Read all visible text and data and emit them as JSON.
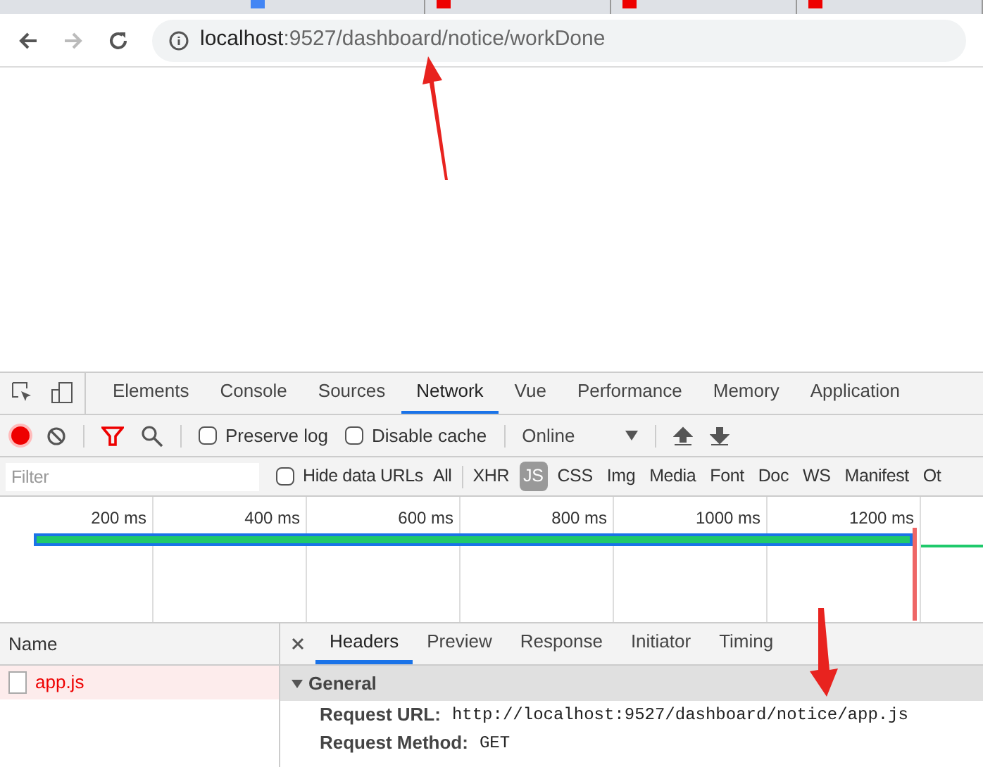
{
  "browser": {
    "url_host": "localhost",
    "url_rest": ":9527/dashboard/notice/workDone"
  },
  "devtools": {
    "tabs": [
      {
        "label": "Elements",
        "selected": false
      },
      {
        "label": "Console",
        "selected": false
      },
      {
        "label": "Sources",
        "selected": false
      },
      {
        "label": "Network",
        "selected": true
      },
      {
        "label": "Vue",
        "selected": false
      },
      {
        "label": "Performance",
        "selected": false
      },
      {
        "label": "Memory",
        "selected": false
      },
      {
        "label": "Application",
        "selected": false
      }
    ],
    "toolbar": {
      "preserve_log": {
        "label": "Preserve log",
        "checked": false
      },
      "disable_cache": {
        "label": "Disable cache",
        "checked": false
      },
      "throttle": "Online"
    },
    "filter": {
      "placeholder": "Filter",
      "hide_data_urls": {
        "label": "Hide data URLs",
        "checked": false
      },
      "types": [
        {
          "label": "All",
          "selected": false
        },
        {
          "label": "XHR",
          "selected": false
        },
        {
          "label": "JS",
          "selected": true
        },
        {
          "label": "CSS",
          "selected": false
        },
        {
          "label": "Img",
          "selected": false
        },
        {
          "label": "Media",
          "selected": false
        },
        {
          "label": "Font",
          "selected": false
        },
        {
          "label": "Doc",
          "selected": false
        },
        {
          "label": "WS",
          "selected": false
        },
        {
          "label": "Manifest",
          "selected": false
        },
        {
          "label": "Ot",
          "selected": false
        }
      ]
    },
    "timeline": {
      "ticks": [
        "200 ms",
        "400 ms",
        "600 ms",
        "800 ms",
        "1000 ms",
        "1200 ms"
      ]
    },
    "requests": {
      "column": "Name",
      "rows": [
        {
          "name": "app.js",
          "selected": true
        }
      ]
    },
    "detail": {
      "tabs": [
        {
          "label": "Headers",
          "selected": true
        },
        {
          "label": "Preview",
          "selected": false
        },
        {
          "label": "Response",
          "selected": false
        },
        {
          "label": "Initiator",
          "selected": false
        },
        {
          "label": "Timing",
          "selected": false
        }
      ],
      "section": "General",
      "fields": [
        {
          "key": "Request URL:",
          "value": "http://localhost:9527/dashboard/notice/app.js"
        },
        {
          "key": "Request Method:",
          "value": "GET"
        }
      ]
    }
  }
}
